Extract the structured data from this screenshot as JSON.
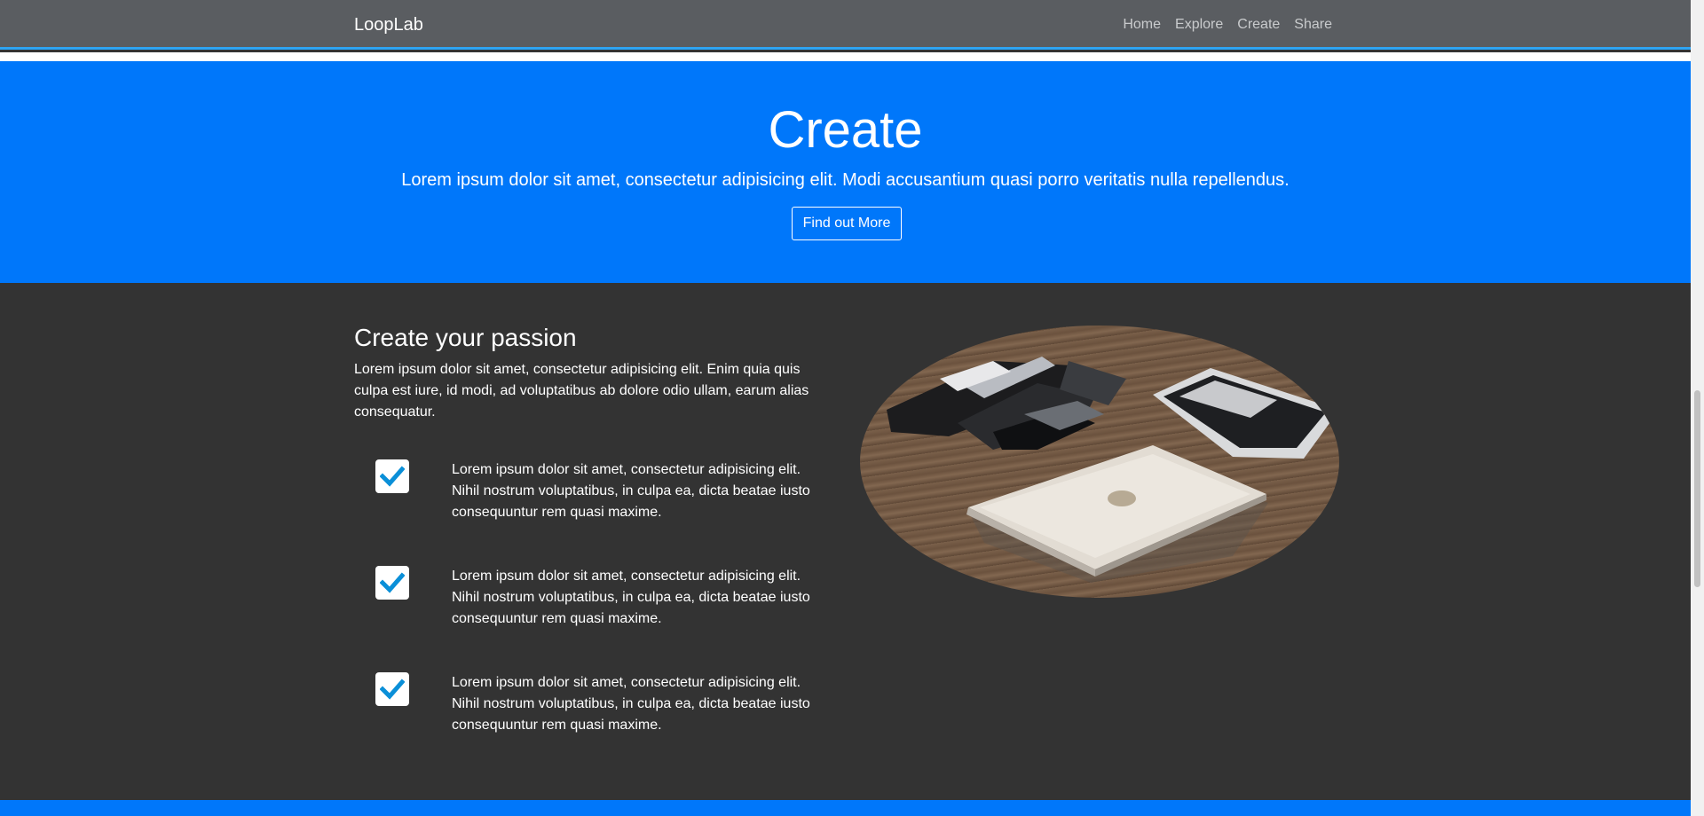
{
  "nav": {
    "brand": "LoopLab",
    "links": [
      "Home",
      "Explore",
      "Create",
      "Share"
    ]
  },
  "hero": {
    "title": "Create",
    "text": "Lorem ipsum dolor sit amet, consectetur adipisicing elit. Modi accusantium quasi porro veritatis nulla repellendus.",
    "button": "Find out More"
  },
  "section": {
    "title": "Create your passion",
    "text": "Lorem ipsum dolor sit amet, consectetur adipisicing elit. Enim quia quis culpa est iure, id modi, ad voluptatibus ab dolore odio ullam, earum alias consequatur.",
    "features": [
      "Lorem ipsum dolor sit amet, consectetur adipisicing elit. Nihil nostrum voluptatibus, in culpa ea, dicta beatae iusto consequuntur rem quasi maxime.",
      "Lorem ipsum dolor sit amet, consectetur adipisicing elit. Nihil nostrum voluptatibus, in culpa ea, dicta beatae iusto consequuntur rem quasi maxime.",
      "Lorem ipsum dolor sit amet, consectetur adipisicing elit. Nihil nostrum voluptatibus, in culpa ea, dicta beatae iusto consequuntur rem quasi maxime."
    ]
  },
  "icons": {
    "feature_check": "check-icon"
  },
  "colors": {
    "navbar": "#5a5d61",
    "accent": "#0077fa",
    "content_bg": "#333333",
    "check": "#0a8fd8"
  }
}
